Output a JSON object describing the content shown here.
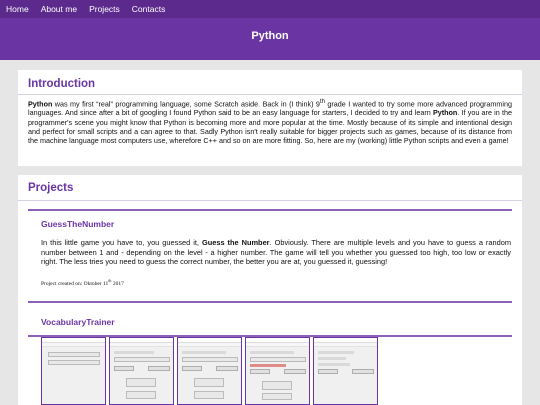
{
  "nav": {
    "items": [
      "Home",
      "About me",
      "Projects",
      "Contacts"
    ]
  },
  "hero": {
    "title": "Python"
  },
  "intro": {
    "heading": "Introduction",
    "text_before_python1": "",
    "python1": "Python",
    "text_after_python1": " was my first “real” programming language, some Scratch aside. Back in (I think) 9",
    "grade_sup": "th",
    "text_mid": " grade I wanted to try some more advanced programming languages. And since after a bit of googling I found Python said to be an easy language for starters, I decided to try and learn ",
    "python2": "Python",
    "text_end": ". If you are in the programmer's scene you might know that Python is becoming more and more popular at the time. Mostly because of its simple and intentional design and perfect for small scripts and a can agree to that. Sadly Python isn't really suitable for bigger projects such as games, because of its distance from the machine language most computers use, wherefore C++ and so on are more fitting. So, here are my (working) little Python scripts and even a game!"
  },
  "projects": {
    "heading": "Projects",
    "items": [
      {
        "title": "GuessTheNumber",
        "text_a": "In this little game you have to, you guessed it, ",
        "text_bold": "Guess the Number",
        "text_b": ". Obviously. There are multiple levels and you have to guess a random number between 1 and - depending on the level - a higher number. The game will tell you whether you guessed too high, too low or exactly right. The less tries you need to guess the correct number, the better you are at, you guessed it, guessing!",
        "created_prefix": "Project created on: Oktober 11",
        "created_sup": "th",
        "created_year": " 2017"
      },
      {
        "title": "VocabularyTrainer"
      }
    ]
  },
  "colors": {
    "accent": "#6a35a3",
    "nav_bg": "#5b2a8c",
    "page_bg": "#e6e6e6"
  }
}
